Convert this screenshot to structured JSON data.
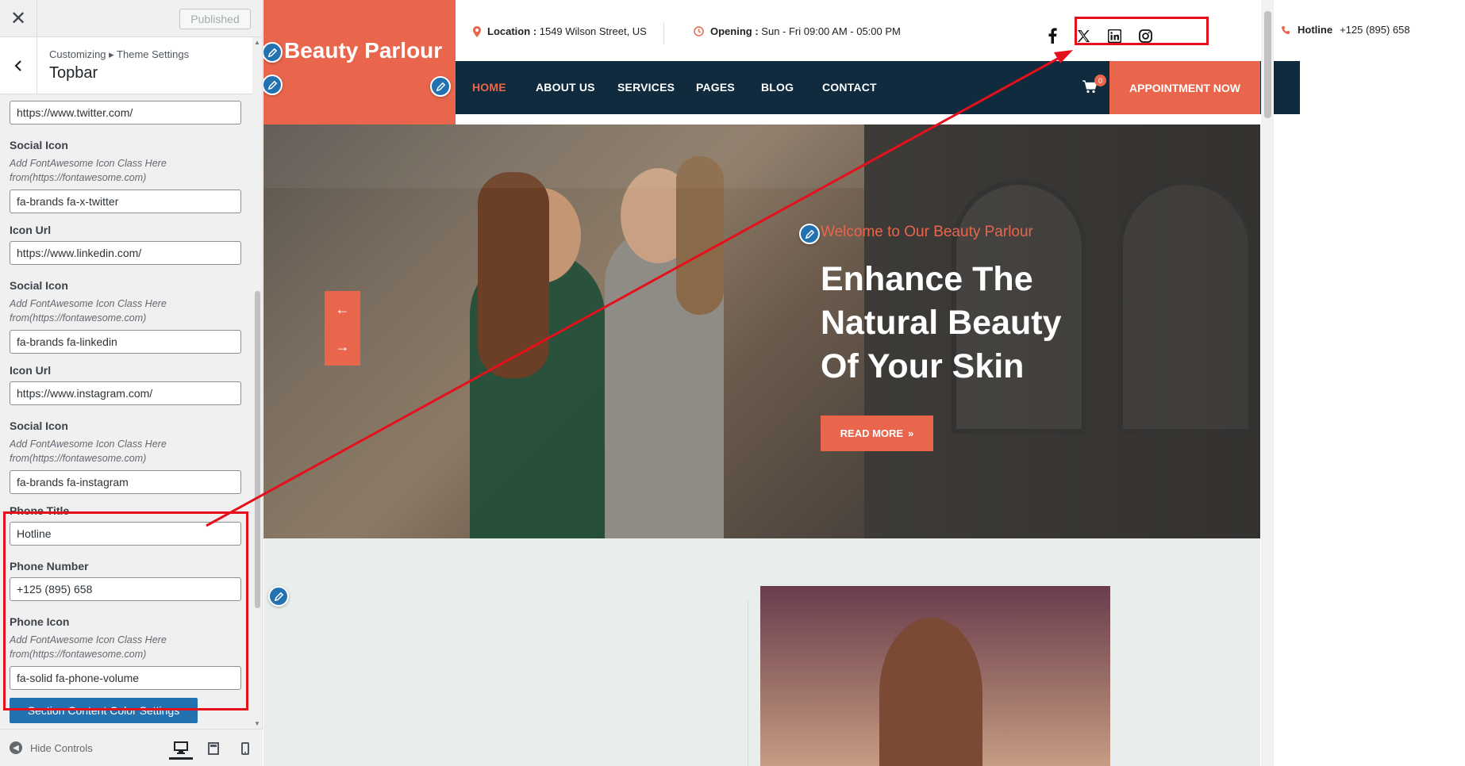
{
  "customizer": {
    "close_label": "✕",
    "publish_label": "Published",
    "breadcrumb": "Customizing ▸ Theme Settings",
    "section_title": "Topbar",
    "fields": [
      {
        "type": "input",
        "value": "https://www.twitter.com/"
      },
      {
        "label": "Social Icon",
        "desc": "Add FontAwesome Icon Class Here from(https://fontawesome.com)",
        "value": "fa-brands fa-x-twitter"
      },
      {
        "label": "Icon Url",
        "value": "https://www.linkedin.com/"
      },
      {
        "label": "Social Icon",
        "desc": "Add FontAwesome Icon Class Here from(https://fontawesome.com)",
        "value": "fa-brands fa-linkedin"
      },
      {
        "label": "Icon Url",
        "value": "https://www.instagram.com/"
      },
      {
        "label": "Social Icon",
        "desc": "Add FontAwesome Icon Class Here from(https://fontawesome.com)",
        "value": "fa-brands fa-instagram"
      },
      {
        "label": "Phone Title",
        "value": "Hotline"
      },
      {
        "label": "Phone Number",
        "value": "+125 (895) 658"
      },
      {
        "label": "Phone Icon",
        "desc": "Add FontAwesome Icon Class Here from(https://fontawesome.com)",
        "value": "fa-solid fa-phone-volume"
      }
    ],
    "section_button": "Section Content Color Settings",
    "hide_controls": "Hide Controls"
  },
  "site": {
    "logo": "Beauty Parlour",
    "location_label": "Location :",
    "location_value": "1549 Wilson Street, US",
    "opening_label": "Opening :",
    "opening_value": "Sun - Fri 09:00 AM - 05:00 PM",
    "hotline_label": "Hotline",
    "hotline_value": "+125 (895) 658",
    "nav": [
      "HOME",
      "ABOUT US",
      "SERVICES",
      "PAGES",
      "BLOG",
      "CONTACT"
    ],
    "cart_count": "0",
    "appointment": "APPOINTMENT NOW",
    "hero": {
      "welcome": "Welcome to Our Beauty Parlour",
      "line1": "Enhance The",
      "line2": "Natural Beauty",
      "line3": "Of Your Skin",
      "button": "READ MORE"
    }
  },
  "colors": {
    "accent": "#e9664c",
    "nav_bg": "#0f2b3d",
    "wp_blue": "#2271b1",
    "annotation": "#e5101b"
  }
}
